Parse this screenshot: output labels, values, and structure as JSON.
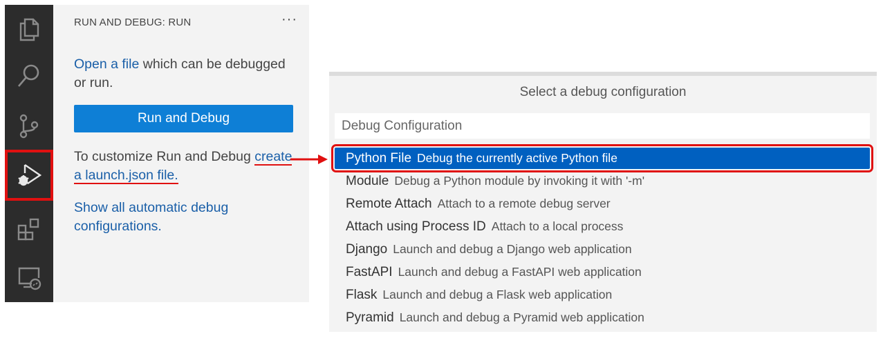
{
  "activity_bar": {
    "icons": [
      "explorer-icon",
      "search-icon",
      "source-control-icon",
      "run-debug-icon",
      "extensions-icon",
      "remote-explorer-icon"
    ],
    "background": "#2c2c2c",
    "selected_highlight": "#e01010"
  },
  "side_bar": {
    "title": "RUN AND DEBUG: RUN",
    "more_label": "···",
    "open_file_link": "Open a file",
    "open_file_rest": " which can be debugged or run.",
    "run_button_label": "Run and Debug",
    "customize_text": "To customize Run and Debug ",
    "create_launch_link": "create a launch.json file.",
    "show_all_link": "Show all automatic debug configurations."
  },
  "quick_pick": {
    "title": "Select a debug configuration",
    "input_placeholder": "Debug Configuration",
    "items": [
      {
        "label": "Python File",
        "description": "Debug the currently active Python file"
      },
      {
        "label": "Module",
        "description": "Debug a Python module by invoking it with '-m'"
      },
      {
        "label": "Remote Attach",
        "description": "Attach to a remote debug server"
      },
      {
        "label": "Attach using Process ID",
        "description": "Attach to a local process"
      },
      {
        "label": "Django",
        "description": "Launch and debug a Django web application"
      },
      {
        "label": "FastAPI",
        "description": "Launch and debug a FastAPI web application"
      },
      {
        "label": "Flask",
        "description": "Launch and debug a Flask web application"
      },
      {
        "label": "Pyramid",
        "description": "Launch and debug a Pyramid web application"
      }
    ],
    "selected_color": "#0060c0"
  },
  "colors": {
    "accent": "#0e7fd6",
    "link": "#1a5fa8",
    "annotation": "#e01010"
  }
}
